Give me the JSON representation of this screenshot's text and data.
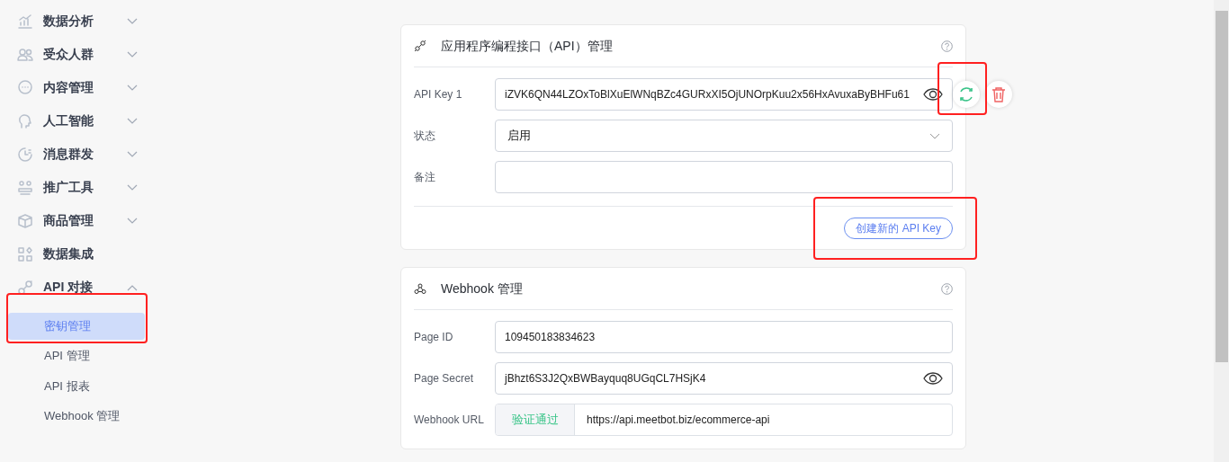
{
  "sidebar": {
    "items": [
      {
        "label": "数据分析",
        "expanded": false
      },
      {
        "label": "受众人群",
        "expanded": false
      },
      {
        "label": "内容管理",
        "expanded": false
      },
      {
        "label": "人工智能",
        "expanded": false
      },
      {
        "label": "消息群发",
        "expanded": false
      },
      {
        "label": "推广工具",
        "expanded": false
      },
      {
        "label": "商品管理",
        "expanded": false
      },
      {
        "label": "数据集成"
      },
      {
        "label": "API 对接",
        "expanded": true,
        "children": [
          {
            "label": "密钥管理",
            "selected": true
          },
          {
            "label": "API 管理",
            "selected": false
          },
          {
            "label": "API 报表",
            "selected": false
          },
          {
            "label": "Webhook 管理",
            "selected": false
          }
        ]
      }
    ]
  },
  "api_card": {
    "title": "应用程序编程接口（API）管理",
    "fields": [
      {
        "kind": "secret",
        "label": "API Key 1",
        "value": "iZVK6QN44LZOxToBlXuElWNqBZc4GURxXI5OjUNOrpKuu2x56HxAvuxaByBHFu61"
      },
      {
        "kind": "select",
        "label": "状态",
        "value": "启用"
      },
      {
        "kind": "text",
        "label": "备注"
      }
    ],
    "create_button": "创建新的 API Key"
  },
  "webhook_card": {
    "title": "Webhook 管理",
    "fields": [
      {
        "kind": "text",
        "label": "Page ID",
        "value": "109450183834623"
      },
      {
        "kind": "secret",
        "label": "Page Secret",
        "value": "jBhzt6S3J2QxBWBayquq8UGqCL7HSjK4"
      },
      {
        "kind": "url",
        "label": "Webhook URL",
        "status": "验证通过",
        "value": "https://api.meetbot.biz/ecommerce-api"
      }
    ]
  }
}
